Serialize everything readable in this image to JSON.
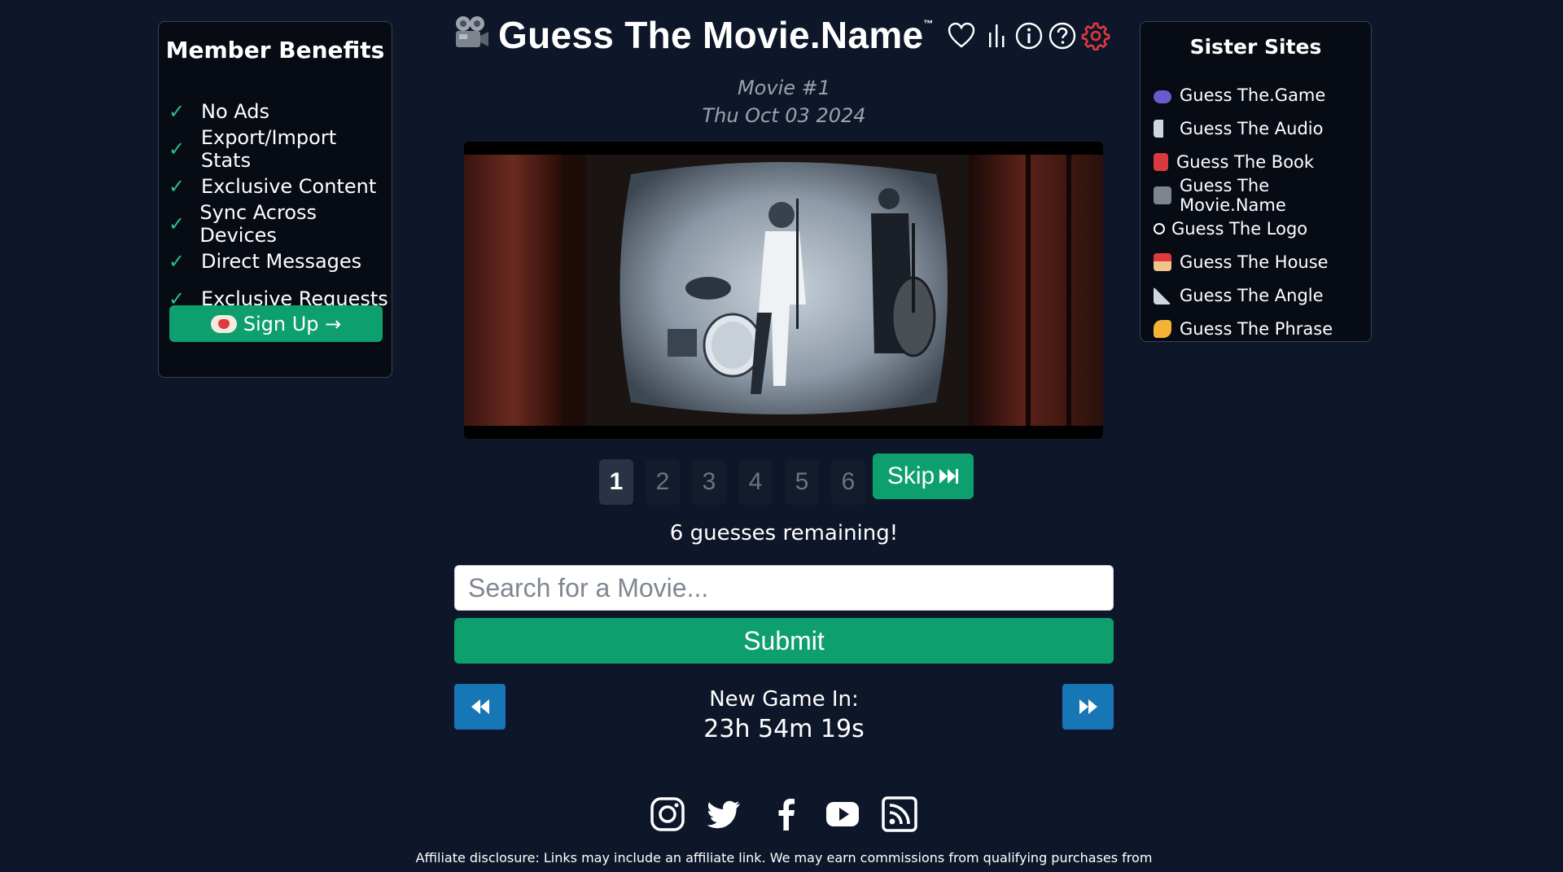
{
  "benefits": {
    "title": "Member Benefits",
    "check_glyph": "✓",
    "items": [
      "No Ads",
      "Export/Import Stats",
      "Exclusive Content",
      "Sync Across Devices",
      "Direct Messages",
      "Exclusive Requests"
    ],
    "signup_label": "Sign Up →"
  },
  "header": {
    "title": "Guess The Movie.Name",
    "tm": "™",
    "icons": [
      "heart-icon",
      "stats-icon",
      "info-icon",
      "help-icon",
      "settings-icon"
    ],
    "settings_color": "#e0393e"
  },
  "puzzle": {
    "movie_number": "Movie #1",
    "date": "Thu Oct 03 2024"
  },
  "guesses": {
    "tabs": [
      "1",
      "2",
      "3",
      "4",
      "5",
      "6"
    ],
    "active": "1",
    "skip_label": "Skip",
    "remaining": "6 guesses remaining!"
  },
  "search": {
    "placeholder": "Search for a Movie...",
    "value": ""
  },
  "submit_label": "Submit",
  "new_game": {
    "label": "New Game In:",
    "countdown": "23h 54m 19s"
  },
  "social": [
    "instagram-icon",
    "twitter-icon",
    "facebook-icon",
    "youtube-icon",
    "rss-icon"
  ],
  "footer": {
    "disclosure": "Affiliate disclosure: Links may include an affiliate link. We may earn commissions from qualifying purchases from"
  },
  "sisters": {
    "title": "Sister Sites",
    "items": [
      {
        "label": "Guess The.Game",
        "icon": "gamepad-icon"
      },
      {
        "label": "Guess The Audio",
        "icon": "speaker-icon"
      },
      {
        "label": "Guess The Book",
        "icon": "book-icon"
      },
      {
        "label": "Guess The Movie.Name",
        "icon": "movie-camera-icon"
      },
      {
        "label": "Guess The Logo",
        "icon": "registered-icon"
      },
      {
        "label": "Guess The House",
        "icon": "house-icon"
      },
      {
        "label": "Guess The Angle",
        "icon": "triangle-ruler-icon"
      },
      {
        "label": "Guess The Phrase",
        "icon": "writing-hand-icon"
      }
    ]
  },
  "colors": {
    "background": "#0e1729",
    "accent_green": "#0e9f6e",
    "nav_blue": "#1676b6"
  }
}
